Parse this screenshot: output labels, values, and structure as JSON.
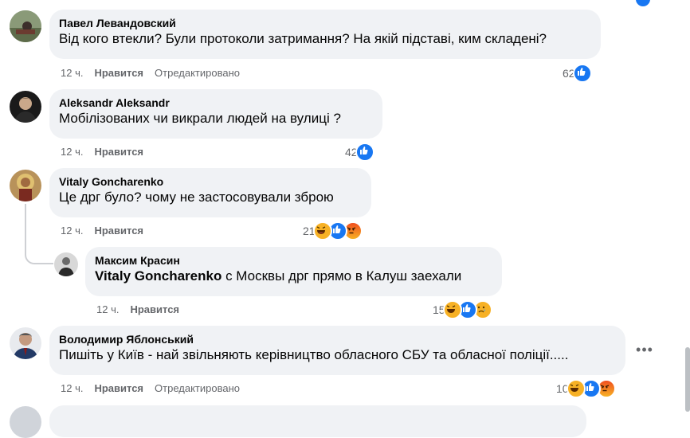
{
  "comments": [
    {
      "author": "Павел Левандовский",
      "text": "Від кого втекли? Були протоколи затримання? На якій підставі, ким складені?",
      "time": "12 ч.",
      "like": "Нравится",
      "edited": "Отредактировано",
      "reactions_count": "62"
    },
    {
      "author": "Aleksandr Aleksandr",
      "text": "Мобілізованих чи викрали людей на вулиці ?",
      "time": "12 ч.",
      "like": "Нравится",
      "reactions_count": "42"
    },
    {
      "author": "Vitaly Goncharenko",
      "text": "Це дрг було? чому не застосовували зброю",
      "time": "12 ч.",
      "like": "Нравится",
      "reactions_count": "21"
    },
    {
      "author": "Максим Красин",
      "tag": "Vitaly Goncharenko",
      "text": " с Москвы дрг прямо в Калуш заехали",
      "time": "12 ч.",
      "like": "Нравится",
      "reactions_count": "15"
    },
    {
      "author": "Володимир Яблонський",
      "text": "Пишіть у Київ - най звільняють керівництво обласного СБУ та обласної поліції.....",
      "time": "12 ч.",
      "like": "Нравится",
      "edited": "Отредактировано",
      "reactions_count": "10"
    }
  ],
  "icons": {
    "like": "like-icon",
    "haha": "haha-icon",
    "angry": "angry-icon",
    "sad": "sad-icon",
    "more": "more-options-icon"
  },
  "colors": {
    "like_blue": "#1877f2",
    "bubble_bg": "#f0f2f5",
    "meta_gray": "#65676b",
    "haha_yellow": "#f7b125",
    "angry_red": "#e9710f"
  }
}
